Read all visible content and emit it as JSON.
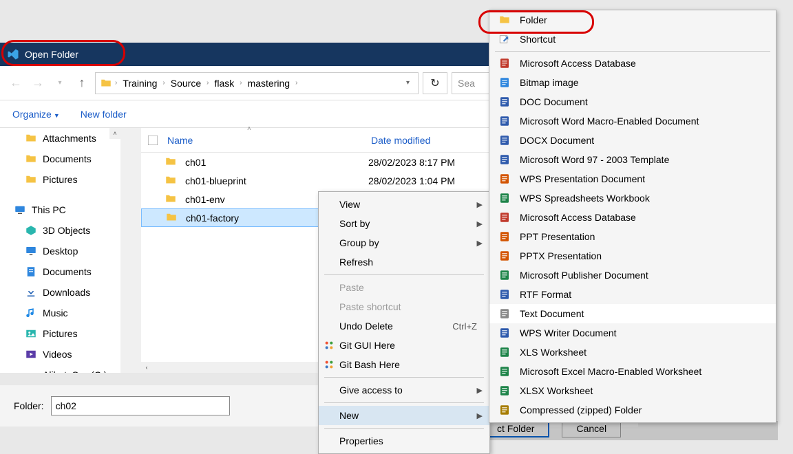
{
  "window": {
    "title": "Open Folder"
  },
  "breadcrumbs": [
    "Training",
    "Source",
    "flask",
    "mastering"
  ],
  "search": {
    "placeholder": "Sea"
  },
  "organize": {
    "organize": "Organize",
    "new_folder": "New folder"
  },
  "nav_tree": {
    "quick": [
      {
        "label": "Attachments",
        "icon": "folder"
      },
      {
        "label": "Documents",
        "icon": "folder"
      },
      {
        "label": "Pictures",
        "icon": "folder"
      }
    ],
    "this_pc_label": "This PC",
    "this_pc": [
      {
        "label": "3D Objects",
        "icon": "3d"
      },
      {
        "label": "Desktop",
        "icon": "desktop"
      },
      {
        "label": "Documents",
        "icon": "docs"
      },
      {
        "label": "Downloads",
        "icon": "downloads"
      },
      {
        "label": "Music",
        "icon": "music"
      },
      {
        "label": "Pictures",
        "icon": "pictures"
      },
      {
        "label": "Videos",
        "icon": "videos"
      },
      {
        "label": "AlibataSys (C:)",
        "icon": "drive"
      }
    ]
  },
  "file_list": {
    "columns": {
      "name": "Name",
      "date": "Date modified"
    },
    "rows": [
      {
        "name": "ch01",
        "date": "28/02/2023 8:17 PM",
        "selected": false
      },
      {
        "name": "ch01-blueprint",
        "date": "28/02/2023 1:04 PM",
        "selected": false
      },
      {
        "name": "ch01-env",
        "date": "",
        "selected": false
      },
      {
        "name": "ch01-factory",
        "date": "",
        "selected": true
      }
    ]
  },
  "folder": {
    "label": "Folder:",
    "value": "ch02",
    "select_btn": "ct Folder",
    "cancel_btn": "Cancel"
  },
  "context_menu": [
    {
      "label": "View",
      "arrow": true
    },
    {
      "label": "Sort by",
      "arrow": true
    },
    {
      "label": "Group by",
      "arrow": true
    },
    {
      "label": "Refresh"
    },
    {
      "sep": true
    },
    {
      "label": "Paste",
      "disabled": true
    },
    {
      "label": "Paste shortcut",
      "disabled": true
    },
    {
      "label": "Undo Delete",
      "shortcut": "Ctrl+Z"
    },
    {
      "label": "Git GUI Here",
      "icon": "git"
    },
    {
      "label": "Git Bash Here",
      "icon": "git"
    },
    {
      "sep": true
    },
    {
      "label": "Give access to",
      "arrow": true
    },
    {
      "sep": true
    },
    {
      "label": "New",
      "arrow": true,
      "hover": true
    },
    {
      "sep": true
    },
    {
      "label": "Properties"
    }
  ],
  "new_menu": [
    {
      "label": "Folder",
      "icon": "folder",
      "color": "#f5c344"
    },
    {
      "label": "Shortcut",
      "icon": "shortcut",
      "color": "#3b78c4"
    },
    {
      "sep": true
    },
    {
      "label": "Microsoft Access Database",
      "icon": "doc",
      "color": "#c0392b"
    },
    {
      "label": "Bitmap image",
      "icon": "doc",
      "color": "#2e86de"
    },
    {
      "label": "DOC Document",
      "icon": "doc",
      "color": "#2e5aac"
    },
    {
      "label": "Microsoft Word Macro-Enabled Document",
      "icon": "doc",
      "color": "#2e5aac"
    },
    {
      "label": "DOCX Document",
      "icon": "doc",
      "color": "#2e5aac"
    },
    {
      "label": "Microsoft Word 97 - 2003 Template",
      "icon": "doc",
      "color": "#2e5aac"
    },
    {
      "label": "WPS Presentation Document",
      "icon": "doc",
      "color": "#d35400"
    },
    {
      "label": "WPS Spreadsheets Workbook",
      "icon": "doc",
      "color": "#1e8449"
    },
    {
      "label": "Microsoft Access Database",
      "icon": "doc",
      "color": "#c0392b"
    },
    {
      "label": "PPT Presentation",
      "icon": "doc",
      "color": "#d35400"
    },
    {
      "label": "PPTX Presentation",
      "icon": "doc",
      "color": "#d35400"
    },
    {
      "label": "Microsoft Publisher Document",
      "icon": "doc",
      "color": "#1e8449"
    },
    {
      "label": "RTF Format",
      "icon": "doc",
      "color": "#2e5aac"
    },
    {
      "label": "Text Document",
      "icon": "doc",
      "color": "#888",
      "hover": true
    },
    {
      "label": "WPS Writer Document",
      "icon": "doc",
      "color": "#2e5aac"
    },
    {
      "label": "XLS Worksheet",
      "icon": "doc",
      "color": "#1e8449"
    },
    {
      "label": "Microsoft Excel Macro-Enabled Worksheet",
      "icon": "doc",
      "color": "#1e8449"
    },
    {
      "label": "XLSX Worksheet",
      "icon": "doc",
      "color": "#1e8449"
    },
    {
      "label": "Compressed (zipped) Folder",
      "icon": "doc",
      "color": "#a67c00"
    }
  ]
}
